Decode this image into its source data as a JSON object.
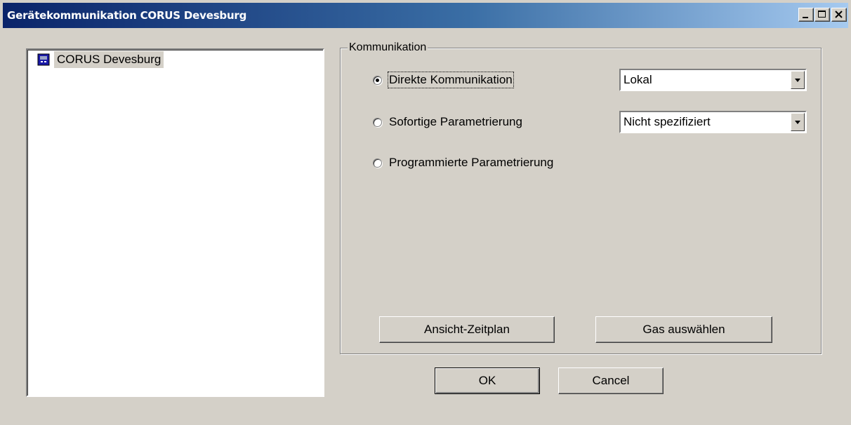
{
  "window": {
    "title": "Gerätekommunikation CORUS Devesburg",
    "controls": {
      "minimize": "minimize-icon",
      "maximize": "maximize-icon",
      "close": "close-icon"
    }
  },
  "tree": {
    "items": [
      {
        "label": "CORUS Devesburg",
        "icon": "device-icon",
        "selected": true
      }
    ]
  },
  "group": {
    "label": "Kommunikation",
    "options": [
      {
        "label": "Direkte Kommunikation",
        "checked": true
      },
      {
        "label": "Sofortige Parametrierung",
        "checked": false
      },
      {
        "label": "Programmierte Parametrierung",
        "checked": false
      }
    ],
    "combos": [
      {
        "value": "Lokal"
      },
      {
        "value": "Nicht spezifiziert"
      }
    ],
    "buttons": {
      "schedule": "Ansicht-Zeitplan",
      "gas": "Gas auswählen"
    }
  },
  "dialog": {
    "ok": "OK",
    "cancel": "Cancel"
  },
  "colors": {
    "titlebar_start": "#0a246a",
    "titlebar_end": "#a6caf0",
    "face": "#d4d0c8"
  }
}
